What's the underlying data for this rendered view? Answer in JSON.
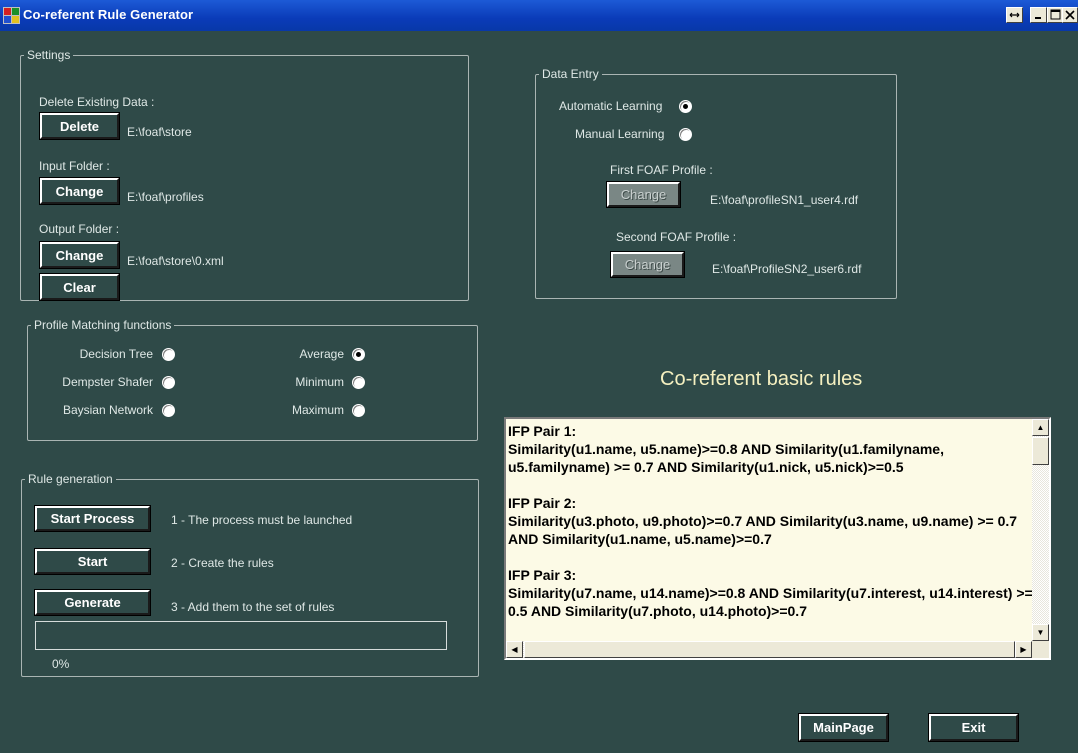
{
  "window": {
    "title": "Co-referent Rule Generator"
  },
  "settings": {
    "legend": "Settings",
    "delete_label": "Delete Existing Data :",
    "delete_button": "Delete",
    "delete_path": "E:\\foaf\\store",
    "input_label": "Input Folder :",
    "input_button": "Change",
    "input_path": "E:\\foaf\\profiles",
    "output_label": "Output Folder :",
    "output_button": "Change",
    "output_path": "E:\\foaf\\store\\0.xml",
    "clear_button": "Clear"
  },
  "data_entry": {
    "legend": "Data Entry",
    "automatic_label": "Automatic Learning",
    "automatic_checked": true,
    "manual_label": "Manual Learning",
    "manual_checked": false,
    "first_profile_label": "First FOAF Profile :",
    "first_profile_button": "Change",
    "first_profile_path": "E:\\foaf\\profileSN1_user4.rdf",
    "second_profile_label": "Second FOAF Profile :",
    "second_profile_button": "Change",
    "second_profile_path": "E:\\foaf\\ProfileSN2_user6.rdf"
  },
  "matching": {
    "legend": "Profile Matching functions",
    "options": [
      {
        "label": "Decision Tree",
        "checked": false
      },
      {
        "label": "Dempster Shafer",
        "checked": false
      },
      {
        "label": "Baysian Network",
        "checked": false
      },
      {
        "label": "Average",
        "checked": true
      },
      {
        "label": "Minimum",
        "checked": false
      },
      {
        "label": "Maximum",
        "checked": false
      }
    ]
  },
  "rule_generation": {
    "legend": "Rule generation",
    "steps": [
      {
        "button": "Start Process",
        "description": "1 - The process must be launched"
      },
      {
        "button": "Start",
        "description": "2 - Create the rules"
      },
      {
        "button": "Generate",
        "description": "3 - Add them to the set of rules"
      }
    ],
    "progress_text": "0%",
    "progress_value": 0
  },
  "rules": {
    "heading": "Co-referent basic rules",
    "pairs": [
      {
        "title": "IFP Pair 1:",
        "rule": "Similarity(u1.name, u5.name)>=0.8 AND Similarity(u1.familyname, u5.familyname) >= 0.7 AND Similarity(u1.nick, u5.nick)>=0.5"
      },
      {
        "title": "IFP Pair 2:",
        "rule": "Similarity(u3.photo, u9.photo)>=0.7 AND Similarity(u3.name, u9.name) >= 0.7 AND Similarity(u1.name, u5.name)>=0.7"
      },
      {
        "title": "IFP Pair 3:",
        "rule": "Similarity(u7.name, u14.name)>=0.8 AND Similarity(u7.interest, u14.interest) >= 0.5 AND Similarity(u7.photo, u14.photo)>=0.7"
      }
    ]
  },
  "footer": {
    "main_page_button": "MainPage",
    "exit_button": "Exit"
  },
  "colors": {
    "background": "#2f4a48",
    "titlebar": "#0a3bb8",
    "rules_bg": "#fcfae6",
    "heading": "#f5f0c0"
  }
}
